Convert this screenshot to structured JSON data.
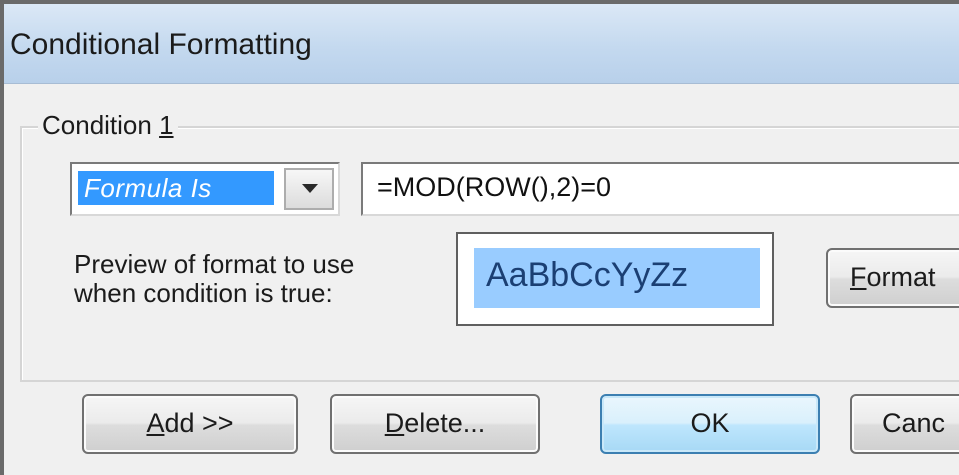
{
  "window": {
    "title": "Conditional Formatting"
  },
  "condition": {
    "group_label_prefix": "Condition ",
    "group_label_number": "1",
    "type_value": "Formula Is",
    "formula": "=MOD(ROW(),2)=0"
  },
  "preview": {
    "label_line1": "Preview of format to use",
    "label_line2": "when condition is true:",
    "sample_text": "AaBbCcYyZz",
    "sample_background": "#99ccff"
  },
  "buttons": {
    "format_mnemonic": "F",
    "format_rest": "ormat",
    "add_mnemonic": "A",
    "add_rest": "dd >>",
    "delete_mnemonic": "D",
    "delete_rest": "elete...",
    "ok": "OK",
    "cancel_visible": "Canc"
  },
  "icons": {
    "dropdown": "chevron-down-icon"
  },
  "colors": {
    "selection": "#3399ff",
    "titlebar": "#c4d9ef",
    "dialog_bg": "#f0f0f0"
  }
}
